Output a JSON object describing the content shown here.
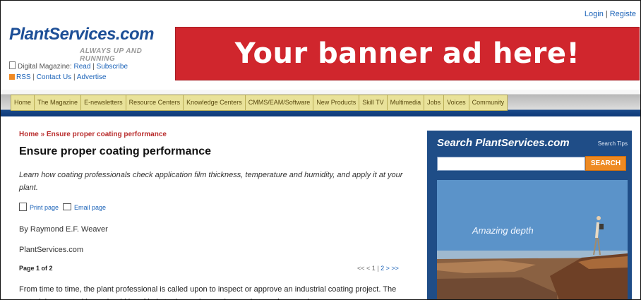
{
  "header": {
    "login": "Login",
    "register": "Registe",
    "logo_name": "PlantServices.com",
    "tagline": "ALWAYS UP AND RUNNING",
    "digital_label": "Digital Magazine:",
    "read": "Read",
    "subscribe": "Subscribe",
    "rss": "RSS",
    "contact": "Contact Us",
    "advertise": "Advertise"
  },
  "banner": {
    "text": "Your banner ad here!"
  },
  "nav": {
    "items": [
      "Home",
      "The Magazine",
      "E-newsletters",
      "Resource Centers",
      "Knowledge Centers",
      "CMMS/EAM/Software",
      "New Products",
      "Skill TV",
      "Multimedia",
      "Jobs",
      "Voices",
      "Community"
    ]
  },
  "article": {
    "breadcrumb": "Home » Ensure proper coating performance",
    "title": "Ensure proper coating performance",
    "intro": "Learn how coating professionals check application film thickness, temperature and humidity, and apply it at your plant.",
    "print": "Print page",
    "email": "Email page",
    "author": "By Raymond E.F. Weaver",
    "source": "PlantServices.com",
    "page_of": "Page 1 of 2",
    "pager_prev": "<< < 1 |",
    "pager_next_num": "2",
    "pager_next": "> >>",
    "body": "From time to time, the plant professional is called upon to inspect or approve an industrial coating project. The material presented here should be of help to the engineer who needs to make sound"
  },
  "sidebar": {
    "title": "Search PlantServices.com",
    "tips": "Search Tips",
    "button": "SEARCH",
    "input_value": "",
    "ad_caption": "Amazing depth"
  },
  "colors": {
    "banner": "#d0262d",
    "nav_tab": "#e9e29a",
    "sidebar": "#1f4d87",
    "search_btn": "#ee8a22"
  }
}
